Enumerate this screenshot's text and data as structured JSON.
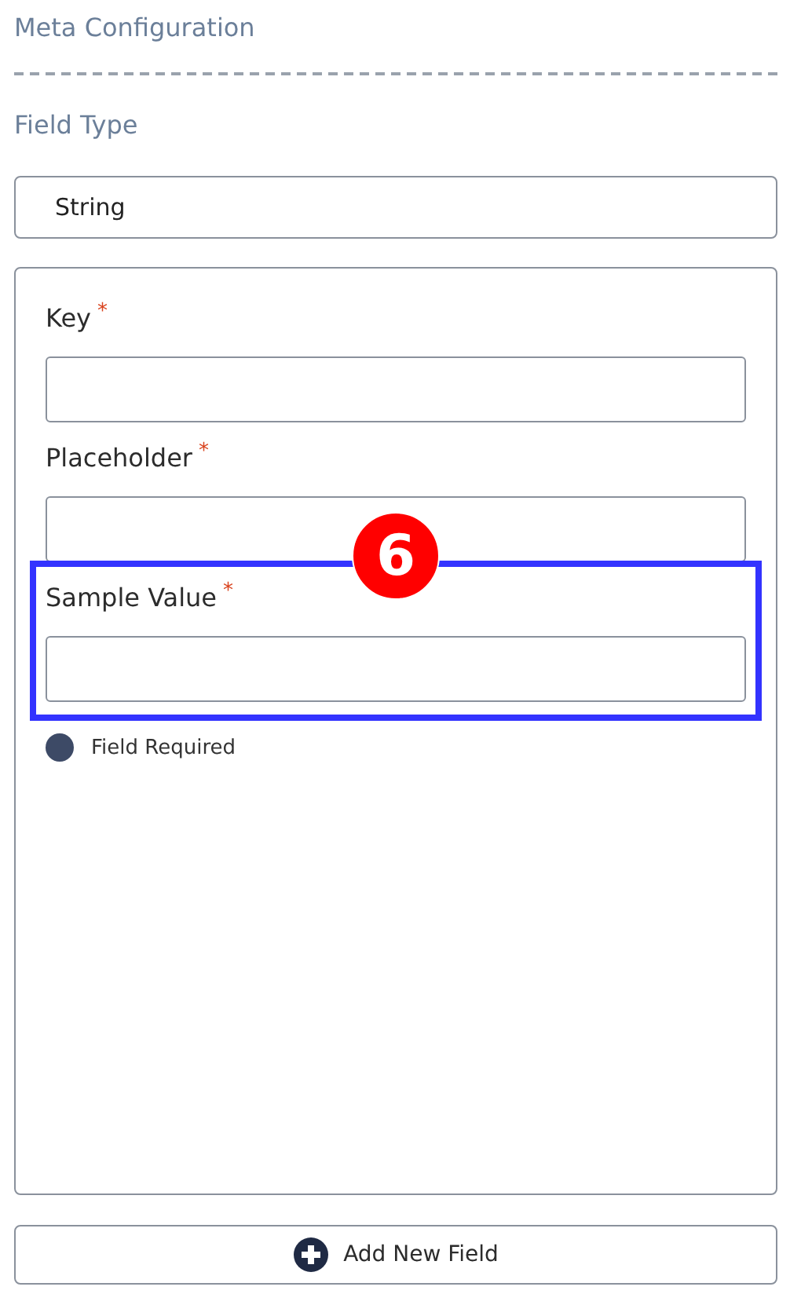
{
  "section_title": "Meta Configuration",
  "field_type": {
    "label": "Field Type",
    "value": "String"
  },
  "fields": [
    {
      "label": "Key",
      "required_mark": "*"
    },
    {
      "label": "Placeholder",
      "required_mark": "*"
    },
    {
      "label": "Sample Value",
      "required_mark": "*",
      "highlighted": true,
      "badge": "6"
    }
  ],
  "required_toggle": {
    "label": "Field Required"
  },
  "add_button": {
    "label": "Add New Field"
  }
}
